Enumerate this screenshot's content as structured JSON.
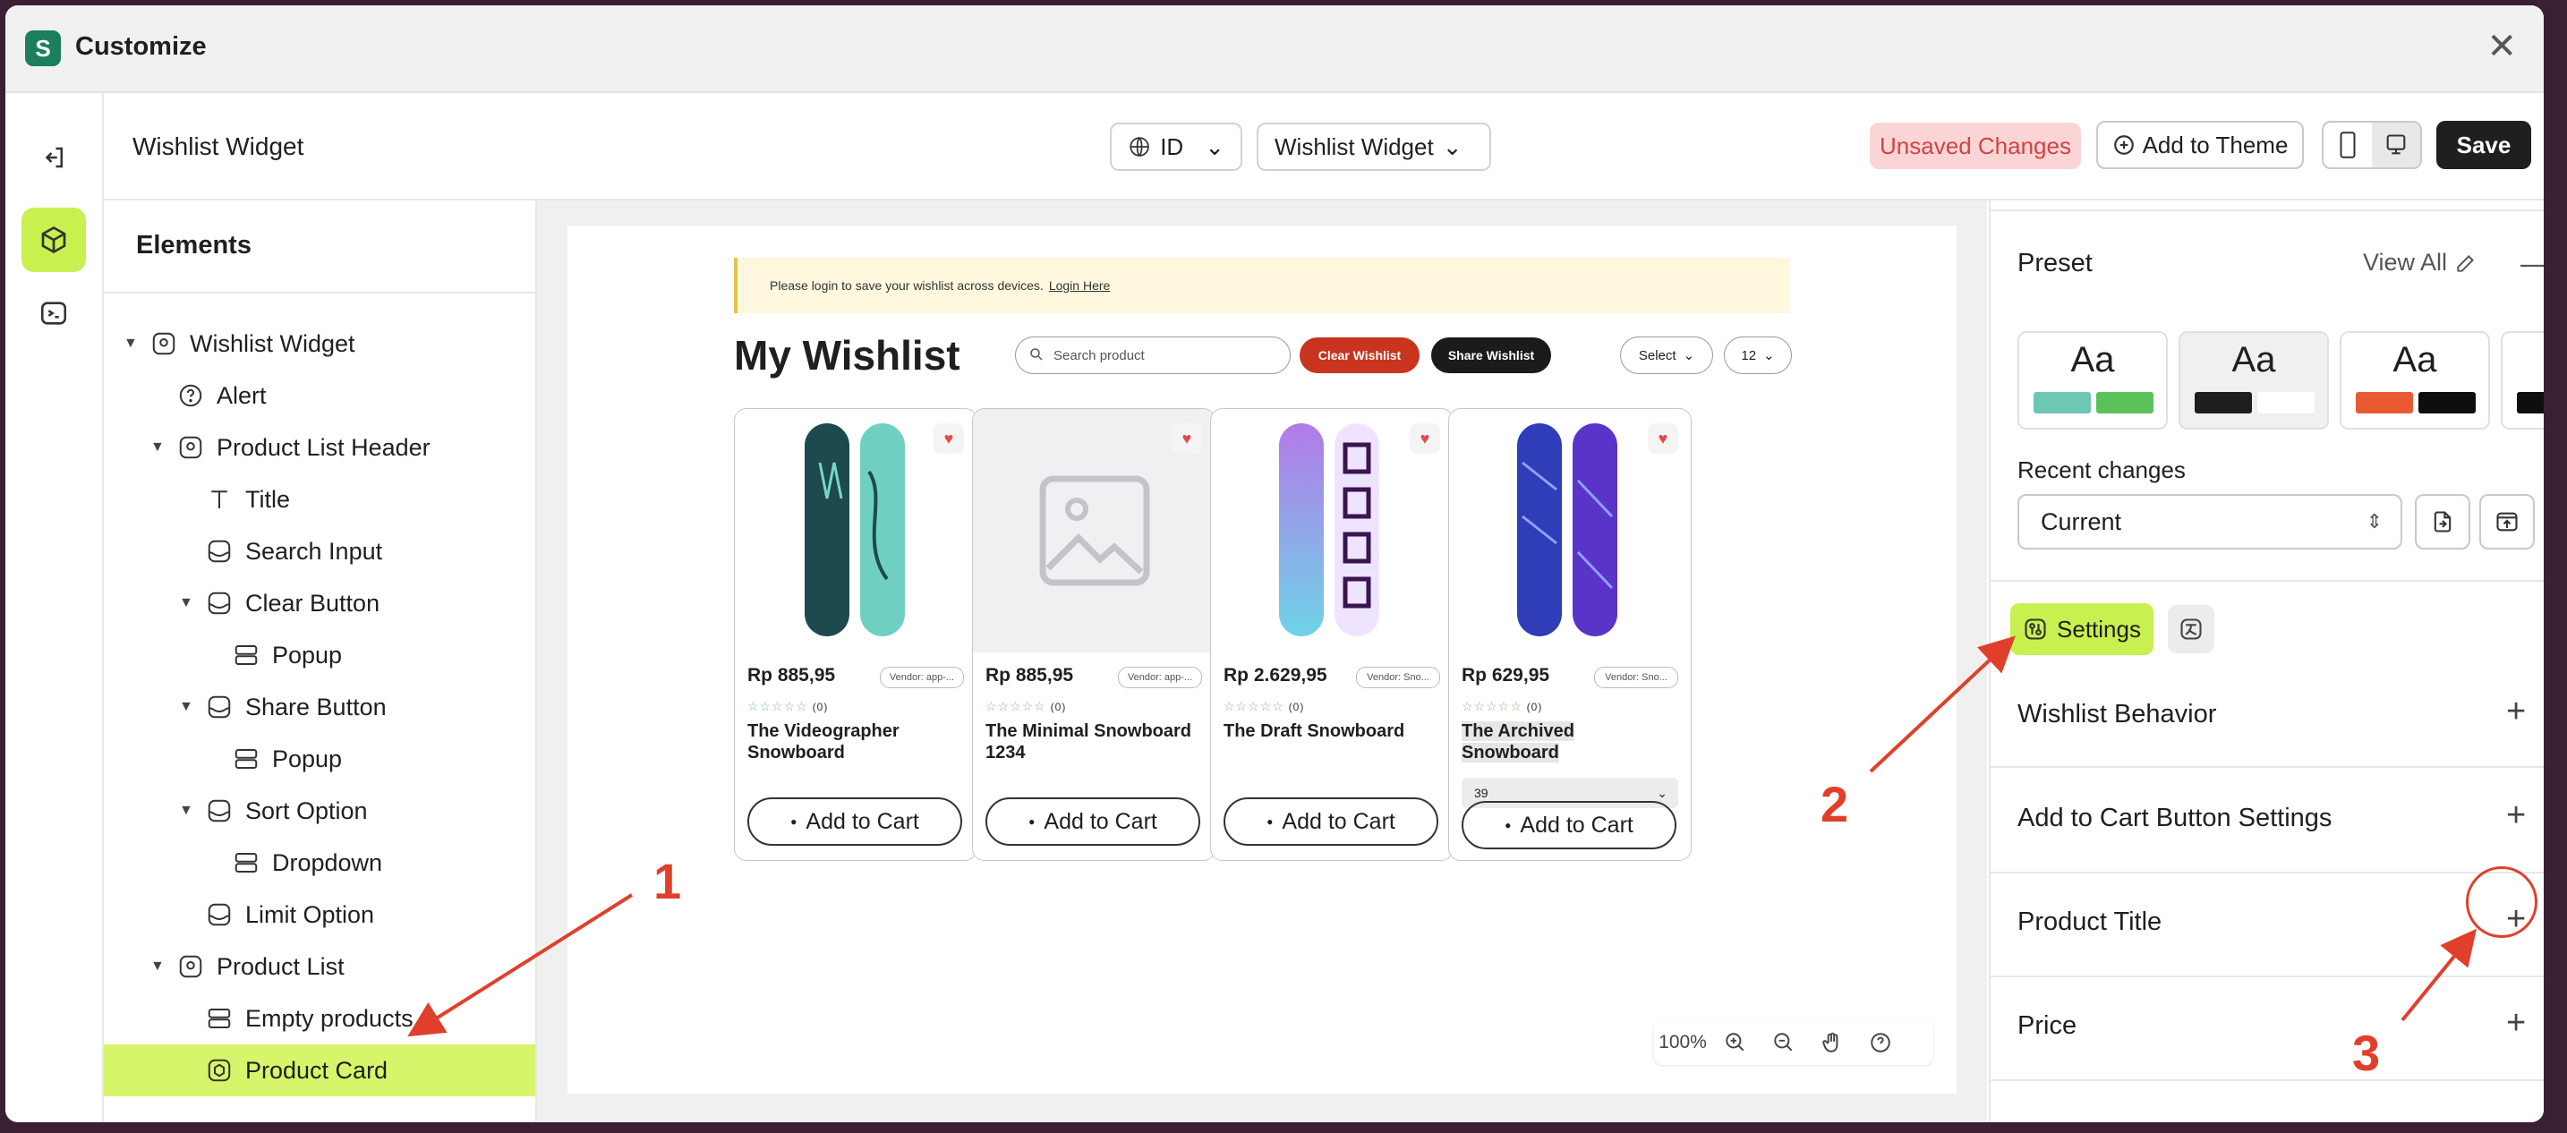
{
  "window": {
    "title": "Customize",
    "logo_letter": "S"
  },
  "topbar": {
    "page_name": "Wishlist Widget",
    "language": "ID",
    "template": "Wishlist Widget",
    "unsaved_label": "Unsaved Changes",
    "add_to_theme_label": "Add to Theme",
    "save_label": "Save"
  },
  "tree": {
    "title": "Elements",
    "items": [
      {
        "label": "Wishlist Widget"
      },
      {
        "label": "Alert"
      },
      {
        "label": "Product List Header"
      },
      {
        "label": "Title"
      },
      {
        "label": "Search Input"
      },
      {
        "label": "Clear Button"
      },
      {
        "label": "Popup"
      },
      {
        "label": "Share Button"
      },
      {
        "label": "Popup"
      },
      {
        "label": "Sort Option"
      },
      {
        "label": "Dropdown"
      },
      {
        "label": "Limit Option"
      },
      {
        "label": "Product List"
      },
      {
        "label": "Empty products"
      },
      {
        "label": "Product Card"
      }
    ]
  },
  "preview": {
    "login_text": "Please login to save your wishlist across devices.",
    "login_link": "Login Here",
    "heading": "My Wishlist",
    "search_placeholder": "Search product",
    "clear_label": "Clear Wishlist",
    "share_label": "Share Wishlist",
    "sort_value": "Select",
    "limit_value": "12",
    "add_to_cart_label": "Add to Cart",
    "rating_count": "(0)",
    "products": [
      {
        "price": "Rp 885,95",
        "vendor": "Vendor: app-...",
        "name": "The Videographer Snowboard"
      },
      {
        "price": "Rp 885,95",
        "vendor": "Vendor: app-...",
        "name": "The Minimal Snowboard 1234"
      },
      {
        "price": "Rp 2.629,95",
        "vendor": "Vendor: Sno...",
        "name": "The Draft Snowboard"
      },
      {
        "price": "Rp 629,95",
        "vendor": "Vendor: Sno...",
        "name": "The Archived Snowboard",
        "variant": "39"
      }
    ]
  },
  "zoom": {
    "level": "100%"
  },
  "settings": {
    "preset_title": "Preset",
    "view_all": "View All",
    "preset_sample": "Aa",
    "recent_label": "Recent changes",
    "recent_value": "Current",
    "settings_tab": "Settings",
    "sections": [
      "Wishlist Behavior",
      "Add to Cart Button Settings",
      "Product Title",
      "Price"
    ]
  },
  "annotations": [
    "1",
    "2",
    "3"
  ],
  "colors": {
    "accent": "#c8f04f",
    "selected": "#d7f56a",
    "annotation": "#e0402b",
    "clear_button": "#c8341e"
  }
}
